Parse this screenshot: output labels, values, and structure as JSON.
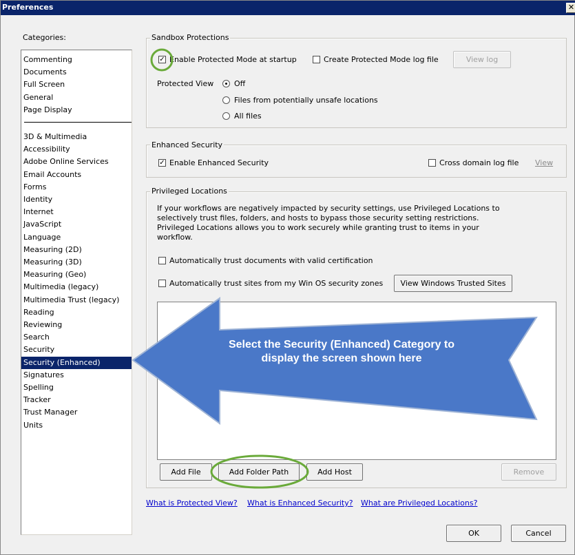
{
  "window": {
    "title": "Preferences",
    "close_glyph": "✕"
  },
  "categories": {
    "label": "Categories:",
    "group_a": [
      "Commenting",
      "Documents",
      "Full Screen",
      "General",
      "Page Display"
    ],
    "group_b": [
      "3D & Multimedia",
      "Accessibility",
      "Adobe Online Services",
      "Email Accounts",
      "Forms",
      "Identity",
      "Internet",
      "JavaScript",
      "Language",
      "Measuring (2D)",
      "Measuring (3D)",
      "Measuring (Geo)",
      "Multimedia (legacy)",
      "Multimedia Trust (legacy)",
      "Reading",
      "Reviewing",
      "Search",
      "Security",
      "Security (Enhanced)",
      "Signatures",
      "Spelling",
      "Tracker",
      "Trust Manager",
      "Units"
    ],
    "selected": "Security (Enhanced)"
  },
  "sandbox": {
    "title": "Sandbox Protections",
    "enable_protected_mode": {
      "label": "Enable Protected Mode at startup",
      "checked": true
    },
    "create_log": {
      "label": "Create Protected Mode log file",
      "checked": false
    },
    "view_log_button": "View log",
    "protected_view_label": "Protected View",
    "options": [
      {
        "label": "Off",
        "selected": true
      },
      {
        "label": "Files from potentially unsafe locations",
        "selected": false
      },
      {
        "label": "All files",
        "selected": false
      }
    ]
  },
  "enhanced": {
    "title": "Enhanced Security",
    "enable": {
      "label": "Enable Enhanced Security",
      "checked": true
    },
    "cross_domain": {
      "label": "Cross domain log file",
      "checked": false
    },
    "view_link": "View"
  },
  "privileged": {
    "title": "Privileged Locations",
    "description": "If your workflows are negatively impacted by security settings, use Privileged Locations to selectively trust files, folders, and hosts to bypass those security setting restrictions. Privileged Locations allows you to work securely while granting trust to items in your workflow.",
    "auto_trust_cert": {
      "label": "Automatically trust documents with valid certification",
      "checked": false
    },
    "auto_trust_sites": {
      "label": "Automatically trust sites from my Win OS security zones",
      "checked": false
    },
    "view_trusted_sites_button": "View Windows Trusted Sites",
    "add_file_button": "Add File",
    "add_folder_button": "Add Folder Path",
    "add_host_button": "Add Host",
    "remove_button": "Remove"
  },
  "links": {
    "protected_view": "What is Protected View?",
    "enhanced_security": "What is Enhanced Security?",
    "privileged_locations": "What are Privileged Locations?"
  },
  "footer": {
    "ok": "OK",
    "cancel": "Cancel"
  },
  "callout": {
    "text": "Select the Security (Enhanced) Category to display the screen shown here",
    "arrow_color": "#4a78c8",
    "highlight_color": "#6aaa3a"
  },
  "icons": {
    "checkmark": "✓"
  }
}
